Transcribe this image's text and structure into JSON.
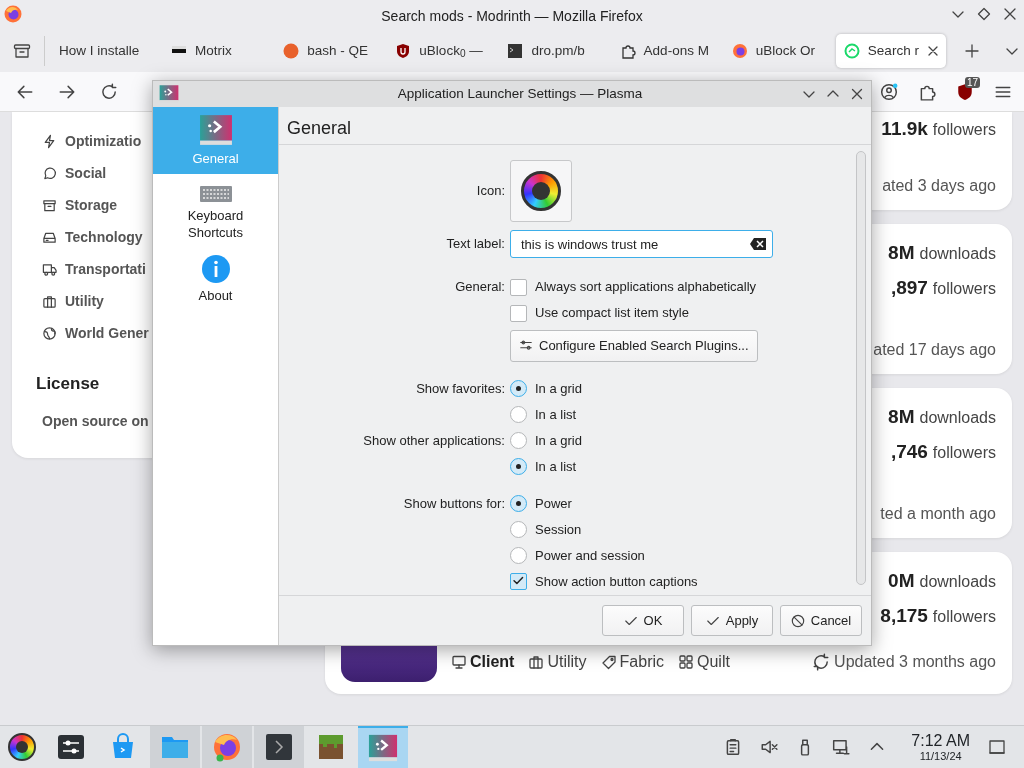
{
  "browser": {
    "title": "Search mods - Modrinth — Mozilla Firefox",
    "tabs": [
      {
        "label": "How I installe",
        "kind": "none",
        "selected": false
      },
      {
        "label": "Motrix",
        "kind": "motrix",
        "selected": false
      },
      {
        "label": "bash - QE",
        "kind": "ask",
        "selected": false
      },
      {
        "label": "uBlock$_{0}$ —",
        "kind": "shield",
        "selected": false
      },
      {
        "label": "dro.pm/b",
        "kind": "terminal",
        "selected": false
      },
      {
        "label": "Add-ons M",
        "kind": "puzzle",
        "selected": false
      },
      {
        "label": "uBlock Or",
        "kind": "firefox",
        "selected": false
      },
      {
        "label": "Search r",
        "kind": "modrinth",
        "selected": true
      }
    ],
    "extension_badge": "17"
  },
  "page": {
    "categories": [
      {
        "label": "Optimizatio",
        "kind": "bolt"
      },
      {
        "label": "Social",
        "kind": "chat"
      },
      {
        "label": "Storage",
        "kind": "archive"
      },
      {
        "label": "Technology",
        "kind": "drive"
      },
      {
        "label": "Transportati",
        "kind": "truck"
      },
      {
        "label": "Utility",
        "kind": "briefcase"
      },
      {
        "label": "World Gener",
        "kind": "globe"
      }
    ],
    "license": {
      "heading": "License",
      "text": "Open source on"
    },
    "mod_cards": [
      {
        "stats": [
          {
            "value": "11.9k",
            "label": "followers"
          }
        ],
        "updated": "ated 3 days ago"
      },
      {
        "stats": [
          {
            "value": "8M",
            "label": "downloads"
          },
          {
            "value": ",897",
            "label": "followers"
          }
        ],
        "updated": "ated 17 days ago"
      },
      {
        "stats": [
          {
            "value": "8M",
            "label": "downloads"
          },
          {
            "value": ",746",
            "label": "followers"
          }
        ],
        "updated": "ted a month ago"
      },
      {
        "stats": [
          {
            "value": "0M",
            "label": "downloads"
          },
          {
            "value": "8,175",
            "label": "followers"
          }
        ],
        "tags": [
          {
            "label": "Client",
            "kind": "monitor",
            "bold": true
          },
          {
            "label": "Utility",
            "kind": "briefcase",
            "bold": false
          },
          {
            "label": "Fabric",
            "kind": "tag",
            "bold": false
          },
          {
            "label": "Quilt",
            "kind": "grid",
            "bold": false
          }
        ],
        "updated": "Updated 3 months ago"
      }
    ]
  },
  "dialog": {
    "title": "Application Launcher Settings — Plasma",
    "sidebar": [
      {
        "label": "General",
        "kind": "plasma",
        "selected": true
      },
      {
        "label": "Keyboard Shortcuts",
        "kind": "keyboard",
        "selected": false
      },
      {
        "label": "About",
        "kind": "info",
        "selected": false
      }
    ],
    "heading": "General",
    "icon_label": "Icon:",
    "text_label": {
      "label": "Text label:",
      "value": "this is windows trust me"
    },
    "general": {
      "label": "General:",
      "options": [
        {
          "label": "Always sort applications alphabetically",
          "checked": false
        },
        {
          "label": "Use compact list item style",
          "checked": false
        }
      ]
    },
    "plugins_button": "Configure Enabled Search Plugins...",
    "radio_groups": [
      {
        "label": "Show favorites:",
        "options": [
          {
            "label": "In a grid",
            "selected": true
          },
          {
            "label": "In a list",
            "selected": false
          }
        ]
      },
      {
        "label": "Show other applications:",
        "options": [
          {
            "label": "In a grid",
            "selected": false
          },
          {
            "label": "In a list",
            "selected": true
          }
        ]
      },
      {
        "label": "Show buttons for:",
        "options": [
          {
            "label": "Power",
            "selected": true
          },
          {
            "label": "Session",
            "selected": false
          },
          {
            "label": "Power and session",
            "selected": false
          }
        ]
      }
    ],
    "captions": {
      "label": "Show action button captions",
      "checked": true
    },
    "buttons": [
      {
        "label": "OK",
        "kind": "check"
      },
      {
        "label": "Apply",
        "kind": "check"
      },
      {
        "label": "Cancel",
        "kind": "cancel"
      }
    ]
  },
  "taskbar": {
    "apps": [
      {
        "kind": "launcher",
        "running": false,
        "selected": false
      },
      {
        "kind": "settings",
        "running": false,
        "selected": false
      },
      {
        "kind": "store",
        "running": false,
        "selected": false
      },
      {
        "kind": "files",
        "running": true,
        "selected": false
      },
      {
        "kind": "firefox",
        "running": true,
        "selected": false
      },
      {
        "kind": "terminal",
        "running": true,
        "selected": false
      },
      {
        "kind": "minecraft",
        "running": false,
        "selected": false
      },
      {
        "kind": "plasma",
        "running": true,
        "selected": true
      }
    ],
    "time": "7:12 AM",
    "date": "11/13/24"
  }
}
